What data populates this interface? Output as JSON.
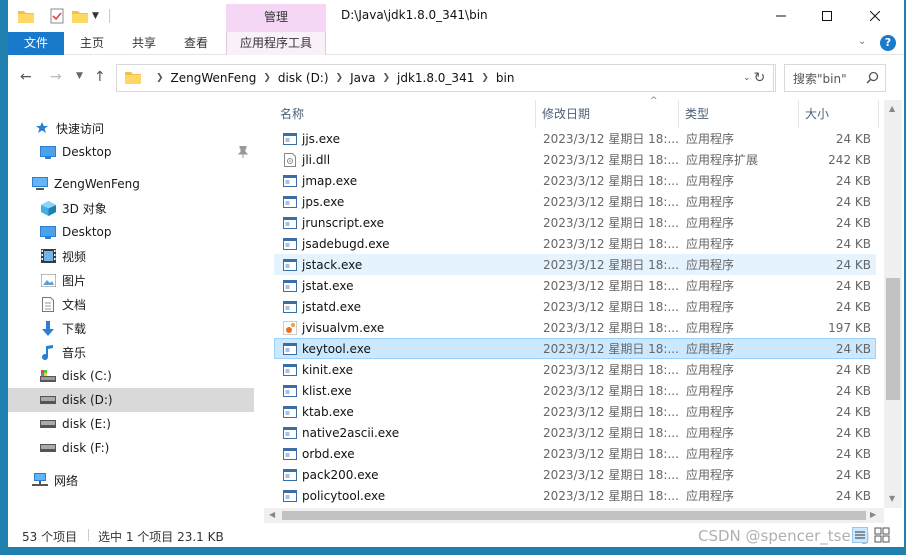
{
  "window": {
    "title": "D:\\Java\\jdk1.8.0_341\\bin",
    "contextual_group": "管理"
  },
  "ribbon": {
    "tabs": [
      "文件",
      "主页",
      "共享",
      "查看",
      "应用程序工具"
    ]
  },
  "address": {
    "crumbs": [
      "ZengWenFeng",
      "disk (D:)",
      "Java",
      "jdk1.8.0_341",
      "bin"
    ],
    "search_placeholder": "搜索\"bin\""
  },
  "navpane": {
    "quick_access": "快速访问",
    "pinned_desktop": "Desktop",
    "this_pc": "ZengWenFeng",
    "items": [
      "3D 对象",
      "Desktop",
      "视频",
      "图片",
      "文档",
      "下载",
      "音乐",
      "disk (C:)",
      "disk (D:)",
      "disk (E:)",
      "disk (F:)"
    ],
    "network": "网络",
    "selected": "disk (D:)"
  },
  "columns": {
    "name": "名称",
    "date": "修改日期",
    "type": "类型",
    "size": "大小"
  },
  "files": [
    {
      "name": "jjs.exe",
      "date": "2023/3/12 星期日 18:...",
      "type": "应用程序",
      "size": "24 KB",
      "icon": "exe-icon"
    },
    {
      "name": "jli.dll",
      "date": "2023/3/12 星期日 18:...",
      "type": "应用程序扩展",
      "size": "242 KB",
      "icon": "dll-icon"
    },
    {
      "name": "jmap.exe",
      "date": "2023/3/12 星期日 18:...",
      "type": "应用程序",
      "size": "24 KB",
      "icon": "exe-icon"
    },
    {
      "name": "jps.exe",
      "date": "2023/3/12 星期日 18:...",
      "type": "应用程序",
      "size": "24 KB",
      "icon": "exe-icon"
    },
    {
      "name": "jrunscript.exe",
      "date": "2023/3/12 星期日 18:...",
      "type": "应用程序",
      "size": "24 KB",
      "icon": "exe-icon"
    },
    {
      "name": "jsadebugd.exe",
      "date": "2023/3/12 星期日 18:...",
      "type": "应用程序",
      "size": "24 KB",
      "icon": "exe-icon"
    },
    {
      "name": "jstack.exe",
      "date": "2023/3/12 星期日 18:...",
      "type": "应用程序",
      "size": "24 KB",
      "icon": "exe-icon"
    },
    {
      "name": "jstat.exe",
      "date": "2023/3/12 星期日 18:...",
      "type": "应用程序",
      "size": "24 KB",
      "icon": "exe-icon"
    },
    {
      "name": "jstatd.exe",
      "date": "2023/3/12 星期日 18:...",
      "type": "应用程序",
      "size": "24 KB",
      "icon": "exe-icon"
    },
    {
      "name": "jvisualvm.exe",
      "date": "2023/3/12 星期日 18:...",
      "type": "应用程序",
      "size": "197 KB",
      "icon": "jvisualvm-icon"
    },
    {
      "name": "keytool.exe",
      "date": "2023/3/12 星期日 18:...",
      "type": "应用程序",
      "size": "24 KB",
      "icon": "exe-icon"
    },
    {
      "name": "kinit.exe",
      "date": "2023/3/12 星期日 18:...",
      "type": "应用程序",
      "size": "24 KB",
      "icon": "exe-icon"
    },
    {
      "name": "klist.exe",
      "date": "2023/3/12 星期日 18:...",
      "type": "应用程序",
      "size": "24 KB",
      "icon": "exe-icon"
    },
    {
      "name": "ktab.exe",
      "date": "2023/3/12 星期日 18:...",
      "type": "应用程序",
      "size": "24 KB",
      "icon": "exe-icon"
    },
    {
      "name": "native2ascii.exe",
      "date": "2023/3/12 星期日 18:...",
      "type": "应用程序",
      "size": "24 KB",
      "icon": "exe-icon"
    },
    {
      "name": "orbd.exe",
      "date": "2023/3/12 星期日 18:...",
      "type": "应用程序",
      "size": "24 KB",
      "icon": "exe-icon"
    },
    {
      "name": "pack200.exe",
      "date": "2023/3/12 星期日 18:...",
      "type": "应用程序",
      "size": "24 KB",
      "icon": "exe-icon"
    },
    {
      "name": "policytool.exe",
      "date": "2023/3/12 星期日 18:...",
      "type": "应用程序",
      "size": "24 KB",
      "icon": "exe-icon"
    }
  ],
  "hovered_file": "jstack.exe",
  "selected_file": "keytool.exe",
  "status": {
    "item_count": "53 个项目",
    "selection": "选中 1 个项目  23.1 KB"
  },
  "watermark": "CSDN @spencer_tseng",
  "colors": {
    "accent": "#1979ca",
    "selection": "#cce8ff",
    "hover": "#e5f3ff",
    "contextual": "#f5d7f5",
    "frame": "#1f7fae"
  }
}
